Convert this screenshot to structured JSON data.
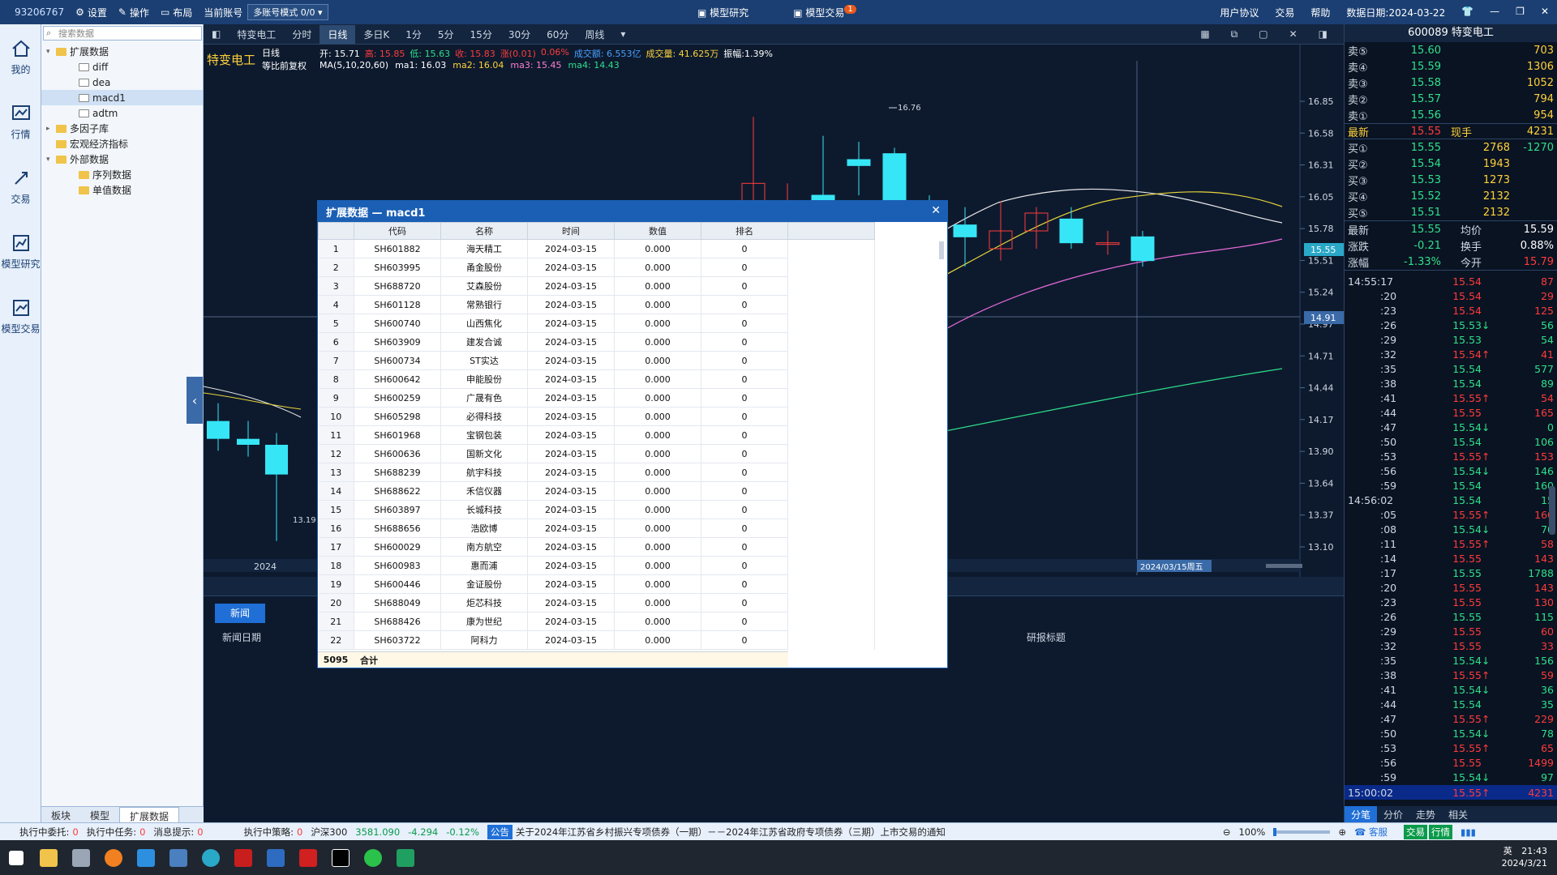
{
  "titlebar": {
    "account_id": "93206767",
    "settings": "设置",
    "operate": "操作",
    "layout": "布局",
    "current_account_label": "当前账号",
    "account_mode": "多账号模式 0/0",
    "model_research": "模型研究",
    "model_trade": "模型交易",
    "model_trade_badge": "1",
    "user_agreement": "用户协议",
    "trade": "交易",
    "help": "帮助",
    "data_date": "数据日期:2024-03-22"
  },
  "lnav": [
    {
      "label": "我的",
      "icon": "home-icon"
    },
    {
      "label": "行情",
      "icon": "chart-icon"
    },
    {
      "label": "交易",
      "icon": "trade-icon"
    },
    {
      "label": "模型研究",
      "icon": "research-icon"
    },
    {
      "label": "模型交易",
      "icon": "model-trade-icon"
    }
  ],
  "tree": {
    "search_placeholder": "搜索数据",
    "nodes": [
      {
        "label": "扩展数据",
        "level": 0,
        "type": "folder",
        "arrow": "▾"
      },
      {
        "label": "diff",
        "level": 2,
        "type": "ofolder",
        "arrow": ""
      },
      {
        "label": "dea",
        "level": 2,
        "type": "ofolder",
        "arrow": ""
      },
      {
        "label": "macd1",
        "level": 2,
        "type": "ofolder",
        "arrow": "",
        "selected": true
      },
      {
        "label": "adtm",
        "level": 2,
        "type": "ofolder",
        "arrow": ""
      },
      {
        "label": "多因子库",
        "level": 0,
        "type": "folder",
        "arrow": "▸"
      },
      {
        "label": "宏观经济指标",
        "level": 0,
        "type": "folder",
        "arrow": ""
      },
      {
        "label": "外部数据",
        "level": 0,
        "type": "folder",
        "arrow": "▾"
      },
      {
        "label": "序列数据",
        "level": 2,
        "type": "folder",
        "arrow": ""
      },
      {
        "label": "单值数据",
        "level": 2,
        "type": "folder",
        "arrow": ""
      }
    ],
    "tabs": [
      "板块",
      "模型",
      "扩展数据"
    ]
  },
  "chart_toolbar": {
    "stock": "特变电工",
    "periods": [
      "分时",
      "日线",
      "多日K",
      "1分",
      "5分",
      "15分",
      "30分",
      "60分",
      "周线"
    ],
    "active": "日线"
  },
  "chart_info": {
    "name": "特变电工",
    "period": "日线",
    "adjust": "等比前复权",
    "open": "开: 15.71",
    "high": "高: 15.85",
    "low": "低: 15.63",
    "close": "收: 15.83",
    "change": "涨(0.01)",
    "pct": "0.06%",
    "amount": "成交额: 6.553亿",
    "volume": "成交量: 41.625万",
    "amplitude": "振幅:1.39%",
    "ma_label": "MA(5,10,20,60)",
    "ma1": "ma1: 16.03",
    "ma2": "ma2: 16.04",
    "ma3": "ma3: 15.45",
    "ma4": "ma4: 14.43"
  },
  "chart_data": {
    "type": "candlestick",
    "price_axis": [
      "16.85",
      "16.58",
      "16.31",
      "16.05",
      "15.78",
      "15.51",
      "15.24",
      "14.97",
      "14.71",
      "14.44",
      "14.17",
      "13.90",
      "13.64",
      "13.37",
      "13.10"
    ],
    "ylim": [
      13.1,
      16.85
    ],
    "current_price": "15.55",
    "crosshair_price": "14.91",
    "high_label": "16.76",
    "low_label": "13.19",
    "x_label": "2024",
    "cursor_date": "2024/03/15周五",
    "candles": [
      {
        "o": 15.5,
        "h": 16.76,
        "l": 15.3,
        "c": 16.2,
        "col": "red"
      },
      {
        "o": 16.0,
        "h": 16.2,
        "l": 15.8,
        "c": 16.0,
        "col": "red"
      },
      {
        "o": 16.1,
        "h": 16.6,
        "l": 15.9,
        "c": 16.0,
        "col": "cyan"
      },
      {
        "o": 16.4,
        "h": 16.55,
        "l": 16.1,
        "c": 16.35,
        "col": "cyan"
      },
      {
        "o": 16.45,
        "h": 16.5,
        "l": 15.9,
        "c": 16.0,
        "col": "cyan"
      },
      {
        "o": 16.0,
        "h": 16.1,
        "l": 15.8,
        "c": 15.9,
        "col": "cyan"
      },
      {
        "o": 15.85,
        "h": 16.0,
        "l": 15.5,
        "c": 15.75,
        "col": "cyan"
      },
      {
        "o": 15.65,
        "h": 16.05,
        "l": 15.55,
        "c": 15.8,
        "col": "red"
      },
      {
        "o": 15.8,
        "h": 16.0,
        "l": 15.65,
        "c": 15.95,
        "col": "red"
      },
      {
        "o": 15.9,
        "h": 16.0,
        "l": 15.65,
        "c": 15.7,
        "col": "cyan"
      },
      {
        "o": 15.7,
        "h": 15.8,
        "l": 15.6,
        "c": 15.7,
        "col": "red"
      },
      {
        "o": 15.75,
        "h": 15.8,
        "l": 15.5,
        "c": 15.55,
        "col": "cyan"
      }
    ],
    "left_candles": [
      {
        "o": 14.2,
        "h": 14.35,
        "l": 13.95,
        "c": 14.05,
        "col": "cyan"
      },
      {
        "o": 14.05,
        "h": 14.2,
        "l": 13.9,
        "c": 14.0,
        "col": "cyan"
      },
      {
        "o": 14.0,
        "h": 14.1,
        "l": 13.19,
        "c": 13.75,
        "col": "cyan"
      }
    ]
  },
  "news": {
    "button": "新闻",
    "col_date": "新闻日期",
    "col_title": "研报标题"
  },
  "dialog": {
    "title": "扩展数据 — macd1",
    "headers": [
      "代码",
      "名称",
      "时间",
      "数值",
      "排名"
    ],
    "rows": [
      [
        "SH601882",
        "海天精工",
        "2024-03-15",
        "0.000",
        "0"
      ],
      [
        "SH603995",
        "甬金股份",
        "2024-03-15",
        "0.000",
        "0"
      ],
      [
        "SH688720",
        "艾森股份",
        "2024-03-15",
        "0.000",
        "0"
      ],
      [
        "SH601128",
        "常熟银行",
        "2024-03-15",
        "0.000",
        "0"
      ],
      [
        "SH600740",
        "山西焦化",
        "2024-03-15",
        "0.000",
        "0"
      ],
      [
        "SH603909",
        "建发合诚",
        "2024-03-15",
        "0.000",
        "0"
      ],
      [
        "SH600734",
        "ST实达",
        "2024-03-15",
        "0.000",
        "0"
      ],
      [
        "SH600642",
        "申能股份",
        "2024-03-15",
        "0.000",
        "0"
      ],
      [
        "SH600259",
        "广晟有色",
        "2024-03-15",
        "0.000",
        "0"
      ],
      [
        "SH605298",
        "必得科技",
        "2024-03-15",
        "0.000",
        "0"
      ],
      [
        "SH601968",
        "宝钢包装",
        "2024-03-15",
        "0.000",
        "0"
      ],
      [
        "SH600636",
        "国新文化",
        "2024-03-15",
        "0.000",
        "0"
      ],
      [
        "SH688239",
        "航宇科技",
        "2024-03-15",
        "0.000",
        "0"
      ],
      [
        "SH688622",
        "禾信仪器",
        "2024-03-15",
        "0.000",
        "0"
      ],
      [
        "SH603897",
        "长城科技",
        "2024-03-15",
        "0.000",
        "0"
      ],
      [
        "SH688656",
        "浩欧博",
        "2024-03-15",
        "0.000",
        "0"
      ],
      [
        "SH600029",
        "南方航空",
        "2024-03-15",
        "0.000",
        "0"
      ],
      [
        "SH600983",
        "惠而浦",
        "2024-03-15",
        "0.000",
        "0"
      ],
      [
        "SH600446",
        "金证股份",
        "2024-03-15",
        "0.000",
        "0"
      ],
      [
        "SH688049",
        "炬芯科技",
        "2024-03-15",
        "0.000",
        "0"
      ],
      [
        "SH688426",
        "康为世纪",
        "2024-03-15",
        "0.000",
        "0"
      ],
      [
        "SH603722",
        "阿科力",
        "2024-03-15",
        "0.000",
        "0"
      ]
    ],
    "total_count": "5095",
    "total_label": "合计"
  },
  "quote": {
    "header": "600089 特变电工",
    "asks": [
      {
        "l": "卖⑤",
        "p": "15.60",
        "v": "703"
      },
      {
        "l": "卖④",
        "p": "15.59",
        "v": "1306"
      },
      {
        "l": "卖③",
        "p": "15.58",
        "v": "1052"
      },
      {
        "l": "卖②",
        "p": "15.57",
        "v": "794"
      },
      {
        "l": "卖①",
        "p": "15.56",
        "v": "954"
      }
    ],
    "last": {
      "l": "最新",
      "p": "15.55",
      "extra": "现手",
      "v": "4231"
    },
    "bids": [
      {
        "l": "买①",
        "p": "15.55",
        "v": "2768",
        "d": "-1270"
      },
      {
        "l": "买②",
        "p": "15.54",
        "v": "1943",
        "d": ""
      },
      {
        "l": "买③",
        "p": "15.53",
        "v": "1273",
        "d": ""
      },
      {
        "l": "买④",
        "p": "15.52",
        "v": "2132",
        "d": ""
      },
      {
        "l": "买⑤",
        "p": "15.51",
        "v": "2132",
        "d": ""
      }
    ],
    "stats": [
      {
        "a": "最新",
        "b": "15.55",
        "c": "均价",
        "d": "15.59"
      },
      {
        "a": "涨跌",
        "b": "-0.21",
        "c": "换手",
        "d": "0.88%"
      },
      {
        "a": "涨幅",
        "b": "-1.33%",
        "c": "今开",
        "d": "15.79"
      }
    ],
    "ticks": [
      {
        "t": "14:55:17",
        "p": "15.54",
        "v": "87",
        "c": "red",
        "a": ""
      },
      {
        "t": ":20",
        "p": "15.54",
        "v": "29",
        "c": "red",
        "a": ""
      },
      {
        "t": ":23",
        "p": "15.54",
        "v": "125",
        "c": "red",
        "a": ""
      },
      {
        "t": ":26",
        "p": "15.53",
        "v": "56",
        "c": "green",
        "a": "↓"
      },
      {
        "t": ":29",
        "p": "15.53",
        "v": "54",
        "c": "green",
        "a": ""
      },
      {
        "t": ":32",
        "p": "15.54",
        "v": "41",
        "c": "red",
        "a": "↑"
      },
      {
        "t": ":35",
        "p": "15.54",
        "v": "577",
        "c": "green",
        "a": ""
      },
      {
        "t": ":38",
        "p": "15.54",
        "v": "89",
        "c": "green",
        "a": ""
      },
      {
        "t": ":41",
        "p": "15.55",
        "v": "54",
        "c": "red",
        "a": "↑"
      },
      {
        "t": ":44",
        "p": "15.55",
        "v": "165",
        "c": "red",
        "a": ""
      },
      {
        "t": ":47",
        "p": "15.54",
        "v": "0",
        "c": "green",
        "a": "↓"
      },
      {
        "t": ":50",
        "p": "15.54",
        "v": "106",
        "c": "green",
        "a": ""
      },
      {
        "t": ":53",
        "p": "15.55",
        "v": "153",
        "c": "red",
        "a": "↑"
      },
      {
        "t": ":56",
        "p": "15.54",
        "v": "146",
        "c": "green",
        "a": "↓"
      },
      {
        "t": ":59",
        "p": "15.54",
        "v": "160",
        "c": "green",
        "a": ""
      },
      {
        "t": "14:56:02",
        "p": "15.54",
        "v": "15",
        "c": "green",
        "a": ""
      },
      {
        "t": ":05",
        "p": "15.55",
        "v": "160",
        "c": "red",
        "a": "↑"
      },
      {
        "t": ":08",
        "p": "15.54",
        "v": "70",
        "c": "green",
        "a": "↓"
      },
      {
        "t": ":11",
        "p": "15.55",
        "v": "58",
        "c": "red",
        "a": "↑"
      },
      {
        "t": ":14",
        "p": "15.55",
        "v": "143",
        "c": "red",
        "a": ""
      },
      {
        "t": ":17",
        "p": "15.55",
        "v": "1788",
        "c": "green",
        "a": ""
      },
      {
        "t": ":20",
        "p": "15.55",
        "v": "143",
        "c": "red",
        "a": ""
      },
      {
        "t": ":23",
        "p": "15.55",
        "v": "130",
        "c": "red",
        "a": ""
      },
      {
        "t": ":26",
        "p": "15.55",
        "v": "115",
        "c": "green",
        "a": ""
      },
      {
        "t": ":29",
        "p": "15.55",
        "v": "60",
        "c": "red",
        "a": ""
      },
      {
        "t": ":32",
        "p": "15.55",
        "v": "33",
        "c": "red",
        "a": ""
      },
      {
        "t": ":35",
        "p": "15.54",
        "v": "156",
        "c": "green",
        "a": "↓"
      },
      {
        "t": ":38",
        "p": "15.55",
        "v": "59",
        "c": "red",
        "a": "↑"
      },
      {
        "t": ":41",
        "p": "15.54",
        "v": "36",
        "c": "green",
        "a": "↓"
      },
      {
        "t": ":44",
        "p": "15.54",
        "v": "35",
        "c": "green",
        "a": ""
      },
      {
        "t": ":47",
        "p": "15.55",
        "v": "229",
        "c": "red",
        "a": "↑"
      },
      {
        "t": ":50",
        "p": "15.54",
        "v": "78",
        "c": "green",
        "a": "↓"
      },
      {
        "t": ":53",
        "p": "15.55",
        "v": "65",
        "c": "red",
        "a": "↑"
      },
      {
        "t": ":56",
        "p": "15.55",
        "v": "1499",
        "c": "red",
        "a": ""
      },
      {
        "t": ":59",
        "p": "15.54",
        "v": "97",
        "c": "green",
        "a": "↓"
      }
    ],
    "final": {
      "t": "15:00:02",
      "p": "15.55",
      "v": "4231",
      "a": "↑"
    },
    "tabs": [
      "分笔",
      "分价",
      "走势",
      "相关"
    ]
  },
  "status": {
    "exec_order": "执行中委托:",
    "exec_order_n": "0",
    "exec_task": "执行中任务:",
    "exec_task_n": "0",
    "msg": "消息提示:",
    "msg_n": "0",
    "exec_strategy": "执行中策略:",
    "exec_strategy_n": "0",
    "index_name": "沪深300",
    "index_val": "3581.090",
    "index_chg": "-4.294",
    "index_pct": "-0.12%",
    "notice_tag": "公告",
    "notice": "关于2024年江苏省乡村振兴专项债券（一期）－－2024年江苏省政府专项债券（三期）上市交易的通知",
    "zoom": "100%",
    "service": "客服",
    "trade_tag": "交易",
    "quote_tag": "行情"
  },
  "taskbar": {
    "time": "21:43",
    "date": "2024/3/21",
    "ime": "英"
  }
}
